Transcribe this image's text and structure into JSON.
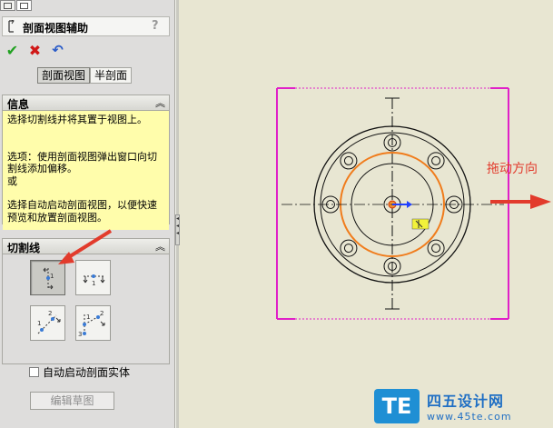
{
  "panel": {
    "title": "剖面视图辅助",
    "help_symbol": "?",
    "tabs": [
      "property-manager-tab",
      "configuration-tab"
    ],
    "actions": [
      {
        "name": "ok",
        "icon": "check-icon",
        "glyph": "✔"
      },
      {
        "name": "cancel",
        "icon": "close-icon",
        "glyph": "✖"
      },
      {
        "name": "undo",
        "icon": "undo-icon",
        "glyph": "↶"
      }
    ],
    "segments": [
      "剖面视图",
      "半剖面"
    ],
    "active_segment": "剖面视图"
  },
  "info": {
    "title": "信息",
    "collapse_symbol": "︽",
    "paragraphs": [
      "选择切割线并将其置于视图上。",
      "选项：使用剖面视图弹出窗口向切割线添加偏移。",
      "或",
      "选择自动启动剖面视图，以便快速预览和放置剖面视图。"
    ]
  },
  "cutline": {
    "title": "切割线",
    "collapse_symbol": "︽",
    "buttons": [
      {
        "name": "vertical-cut-line",
        "active": true
      },
      {
        "name": "horizontal-cut-line",
        "active": false
      },
      {
        "name": "auxiliary-cut-line",
        "active": false
      },
      {
        "name": "aligned-cut-line",
        "active": false
      }
    ],
    "auto_start_label": "自动启动剖面实体",
    "auto_start_checked": false
  },
  "edit_sketch_label": "编辑草图",
  "canvas": {
    "drag_direction_label": "拖动方向",
    "colors": {
      "bracket": "#e020c8",
      "orange_circle": "#f07c1c",
      "annotation_arrow": "#e23b2c",
      "origin": "#d03000"
    }
  },
  "watermark": {
    "logo": "TE",
    "title": "四五设计网",
    "url": "www.45te.com"
  }
}
